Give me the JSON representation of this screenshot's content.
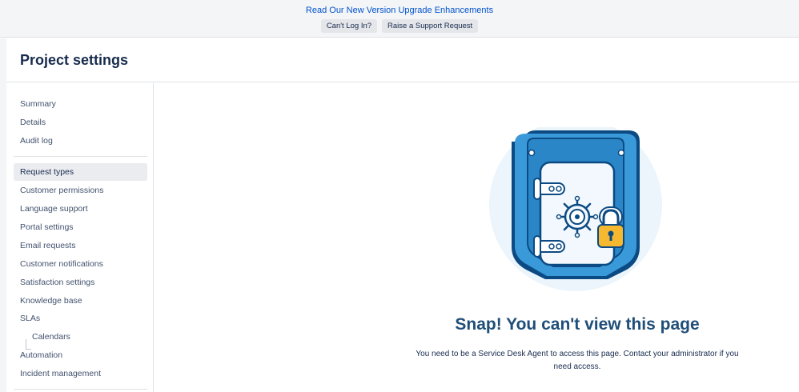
{
  "banner": {
    "link_text": "Read Our New Version Upgrade Enhancements",
    "buttons": [
      "Can't Log In?",
      "Raise a Support Request"
    ]
  },
  "header": {
    "title": "Project settings"
  },
  "sidebar": {
    "group1": [
      "Summary",
      "Details",
      "Audit log"
    ],
    "group2": [
      {
        "label": "Request types",
        "active": true
      },
      {
        "label": "Customer permissions"
      },
      {
        "label": "Language support"
      },
      {
        "label": "Portal settings"
      },
      {
        "label": "Email requests"
      },
      {
        "label": "Customer notifications"
      },
      {
        "label": "Satisfaction settings"
      },
      {
        "label": "Knowledge base"
      },
      {
        "label": "SLAs"
      },
      {
        "label": "Calendars",
        "child_of": "SLAs"
      },
      {
        "label": "Automation"
      },
      {
        "label": "Incident management"
      }
    ]
  },
  "main": {
    "illustration": "locked-vault-icon",
    "title": "Snap! You can't view this page",
    "message": "You need to be a Service Desk Agent to access this page. Contact your administrator if you need access."
  },
  "colors": {
    "link": "#0052cc",
    "title": "#1f4e79",
    "vault_blue": "#3a9ad9",
    "lock_gold": "#f5b82e"
  }
}
